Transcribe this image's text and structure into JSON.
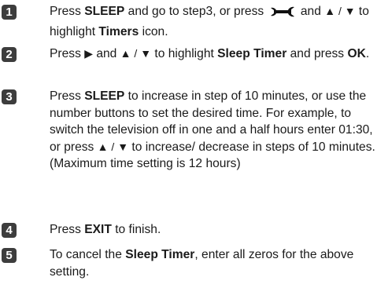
{
  "steps": [
    {
      "number": "1",
      "parts": {
        "a": "Press ",
        "b1": "SLEEP",
        "c": " and go to step3, or press ",
        "d": " and ",
        "e": "▲ / ▼",
        "f": " to highlight ",
        "b2": "Timers",
        "g": " icon."
      },
      "icon": "wrench-tool-icon"
    },
    {
      "number": "2",
      "parts": {
        "a": "Press ",
        "arrow": "▶",
        "b": " and ",
        "c": "▲ / ▼",
        "d": " to highlight ",
        "b1": "Sleep Timer",
        "e": " and press ",
        "b2": "OK",
        "f": "."
      }
    },
    {
      "number": "3",
      "parts": {
        "a": "Press ",
        "b1": "SLEEP",
        "c": " to increase in step of 10 minutes, or use the number buttons to set the desired time. For example, to switch the television off in one and a half hours enter 01:30, or press ",
        "d": "▲ / ▼",
        "e": " to increase/ decrease in steps of 10 minutes. (Maximum time setting is 12 hours)"
      }
    },
    {
      "number": "4",
      "parts": {
        "a": "Press ",
        "b1": "EXIT",
        "c": " to finish."
      }
    },
    {
      "number": "5",
      "parts": {
        "a": "To cancel the ",
        "b1": "Sleep Timer",
        "c": ", enter all zeros for the above setting."
      }
    }
  ]
}
